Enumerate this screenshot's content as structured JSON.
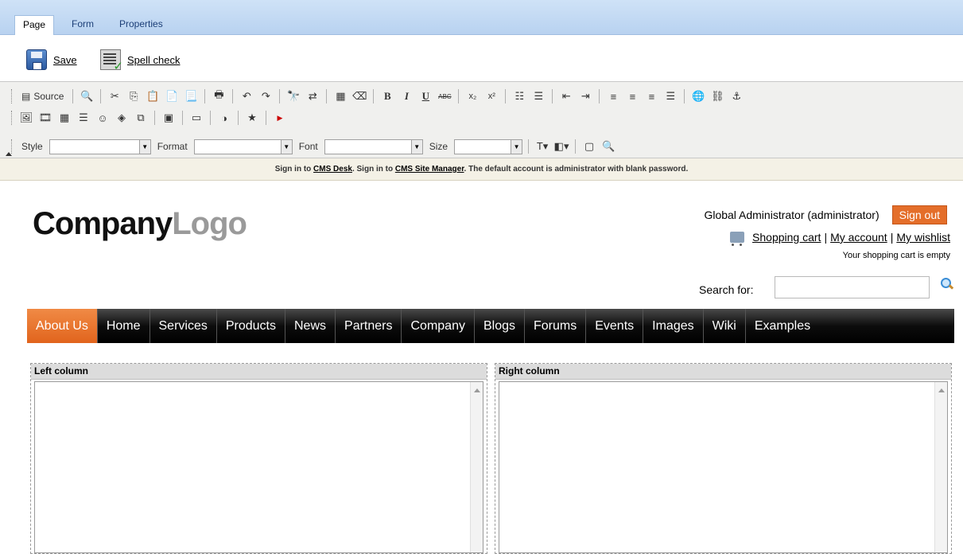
{
  "tabs": [
    {
      "label": "Page",
      "active": true
    },
    {
      "label": "Form",
      "active": false
    },
    {
      "label": "Properties",
      "active": false
    }
  ],
  "actions": {
    "save_label": "Save",
    "spellcheck_label": "Spell check"
  },
  "toolbar": {
    "source_label": "Source",
    "style_label": "Style",
    "format_label": "Format",
    "font_label": "Font",
    "size_label": "Size",
    "style_value": "",
    "format_value": "",
    "font_value": "",
    "size_value": ""
  },
  "infostrip": {
    "part1": "Sign in to ",
    "cms_desk": "CMS Desk",
    "part2": ". Sign in to ",
    "site_manager": "CMS Site Manager",
    "part3": ". The default account is administrator with blank password."
  },
  "header": {
    "logo_main": "Company",
    "logo_accent": "Logo",
    "user_name": "Global Administrator (administrator)",
    "signout_label": "Sign out",
    "shopping_cart": "Shopping cart",
    "my_account": "My account",
    "my_wishlist": "My wishlist",
    "cart_status": "Your shopping cart is empty",
    "search_label": "Search for:",
    "search_value": ""
  },
  "nav": {
    "items": [
      "About Us",
      "Home",
      "Services",
      "Products",
      "News",
      "Partners",
      "Company",
      "Blogs",
      "Forums",
      "Events",
      "Images",
      "Wiki",
      "Examples"
    ],
    "active": "About Us"
  },
  "columns": {
    "left_title": "Left column",
    "right_title": "Right column"
  },
  "colors": {
    "accent_orange": "#e1641d",
    "tabbar_blue": "#b8d2f0",
    "nav_black": "#000000"
  }
}
